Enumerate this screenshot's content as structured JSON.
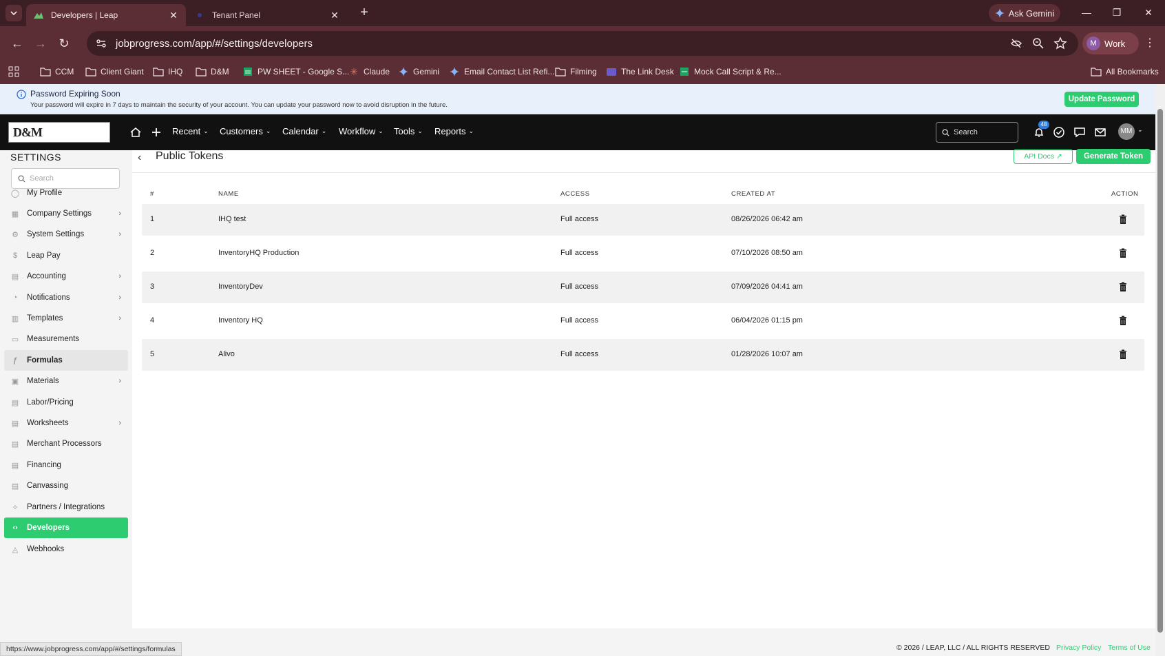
{
  "browser": {
    "tabs": [
      {
        "title": "Developers | Leap",
        "active": true
      },
      {
        "title": "Tenant Panel",
        "active": false
      }
    ],
    "ask_gemini": "Ask Gemini",
    "url": "jobprogress.com/app/#/settings/developers",
    "profile": {
      "initial": "M",
      "label": "Work"
    },
    "bookmarks": [
      "CCM",
      "Client Giant",
      "IHQ",
      "D&M",
      "PW SHEET - Google S...",
      "Claude",
      "Gemini",
      "Email Contact List Refi...",
      "Filming",
      "The Link Desk",
      "Mock Call Script & Re..."
    ],
    "all_bookmarks": "All Bookmarks"
  },
  "banner": {
    "title": "Password Expiring Soon",
    "message": "Your password will expire in 7 days to maintain the security of your account. You can update your password now to avoid disruption in the future.",
    "button": "Update Password"
  },
  "header": {
    "logo_text": "D&M",
    "menu": [
      "Recent",
      "Customers",
      "Calendar",
      "Workflow",
      "Tools",
      "Reports"
    ],
    "search_placeholder": "Search",
    "notification_count": "48",
    "user_initials": "MM"
  },
  "sidebar": {
    "title": "SETTINGS",
    "search_placeholder": "Search",
    "items": [
      {
        "label": "My Profile",
        "icon": "user-icon",
        "chevron": false
      },
      {
        "label": "Company Settings",
        "icon": "building-icon",
        "chevron": true
      },
      {
        "label": "System Settings",
        "icon": "gear-icon",
        "chevron": true
      },
      {
        "label": "Leap Pay",
        "icon": "dollar-icon",
        "chevron": false
      },
      {
        "label": "Accounting",
        "icon": "ledger-icon",
        "chevron": true
      },
      {
        "label": "Notifications",
        "icon": "bell-icon",
        "chevron": true
      },
      {
        "label": "Templates",
        "icon": "template-icon",
        "chevron": true
      },
      {
        "label": "Measurements",
        "icon": "ruler-icon",
        "chevron": false
      },
      {
        "label": "Formulas",
        "icon": "function-icon",
        "chevron": false
      },
      {
        "label": "Materials",
        "icon": "box-icon",
        "chevron": true
      },
      {
        "label": "Labor/Pricing",
        "icon": "price-icon",
        "chevron": false
      },
      {
        "label": "Worksheets",
        "icon": "sheet-icon",
        "chevron": true
      },
      {
        "label": "Merchant Processors",
        "icon": "card-icon",
        "chevron": false
      },
      {
        "label": "Financing",
        "icon": "bank-icon",
        "chevron": false
      },
      {
        "label": "Canvassing",
        "icon": "door-icon",
        "chevron": false
      },
      {
        "label": "Partners / Integrations",
        "icon": "handshake-icon",
        "chevron": false
      },
      {
        "label": "Developers",
        "icon": "code-icon",
        "chevron": false
      },
      {
        "label": "Webhooks",
        "icon": "webhook-icon",
        "chevron": false
      }
    ]
  },
  "main": {
    "title": "Public Tokens",
    "api_docs": "API Docs",
    "generate_token": "Generate Token",
    "columns": [
      "#",
      "NAME",
      "ACCESS",
      "CREATED AT",
      "ACTION"
    ],
    "rows": [
      {
        "num": "1",
        "name": "IHQ test",
        "access": "Full access",
        "created": "08/26/2026 06:42 am"
      },
      {
        "num": "2",
        "name": "InventoryHQ Production",
        "access": "Full access",
        "created": "07/10/2026 08:50 am"
      },
      {
        "num": "3",
        "name": "InventoryDev",
        "access": "Full access",
        "created": "07/09/2026 04:41 am"
      },
      {
        "num": "4",
        "name": "Inventory HQ",
        "access": "Full access",
        "created": "06/04/2026 01:15 pm"
      },
      {
        "num": "5",
        "name": "Alivo",
        "access": "Full access",
        "created": "01/28/2026 10:07 am"
      }
    ]
  },
  "footer": {
    "status_url": "https://www.jobprogress.com/app/#/settings/formulas",
    "copyright": "© 2026 / LEAP, LLC / ALL RIGHTS RESERVED",
    "privacy": "Privacy Policy",
    "terms": "Terms of Use"
  },
  "colors": {
    "accent": "#2ecc71",
    "browser_dark": "#3c1f24",
    "browser_mid": "#5b2d34",
    "header": "#111111"
  }
}
